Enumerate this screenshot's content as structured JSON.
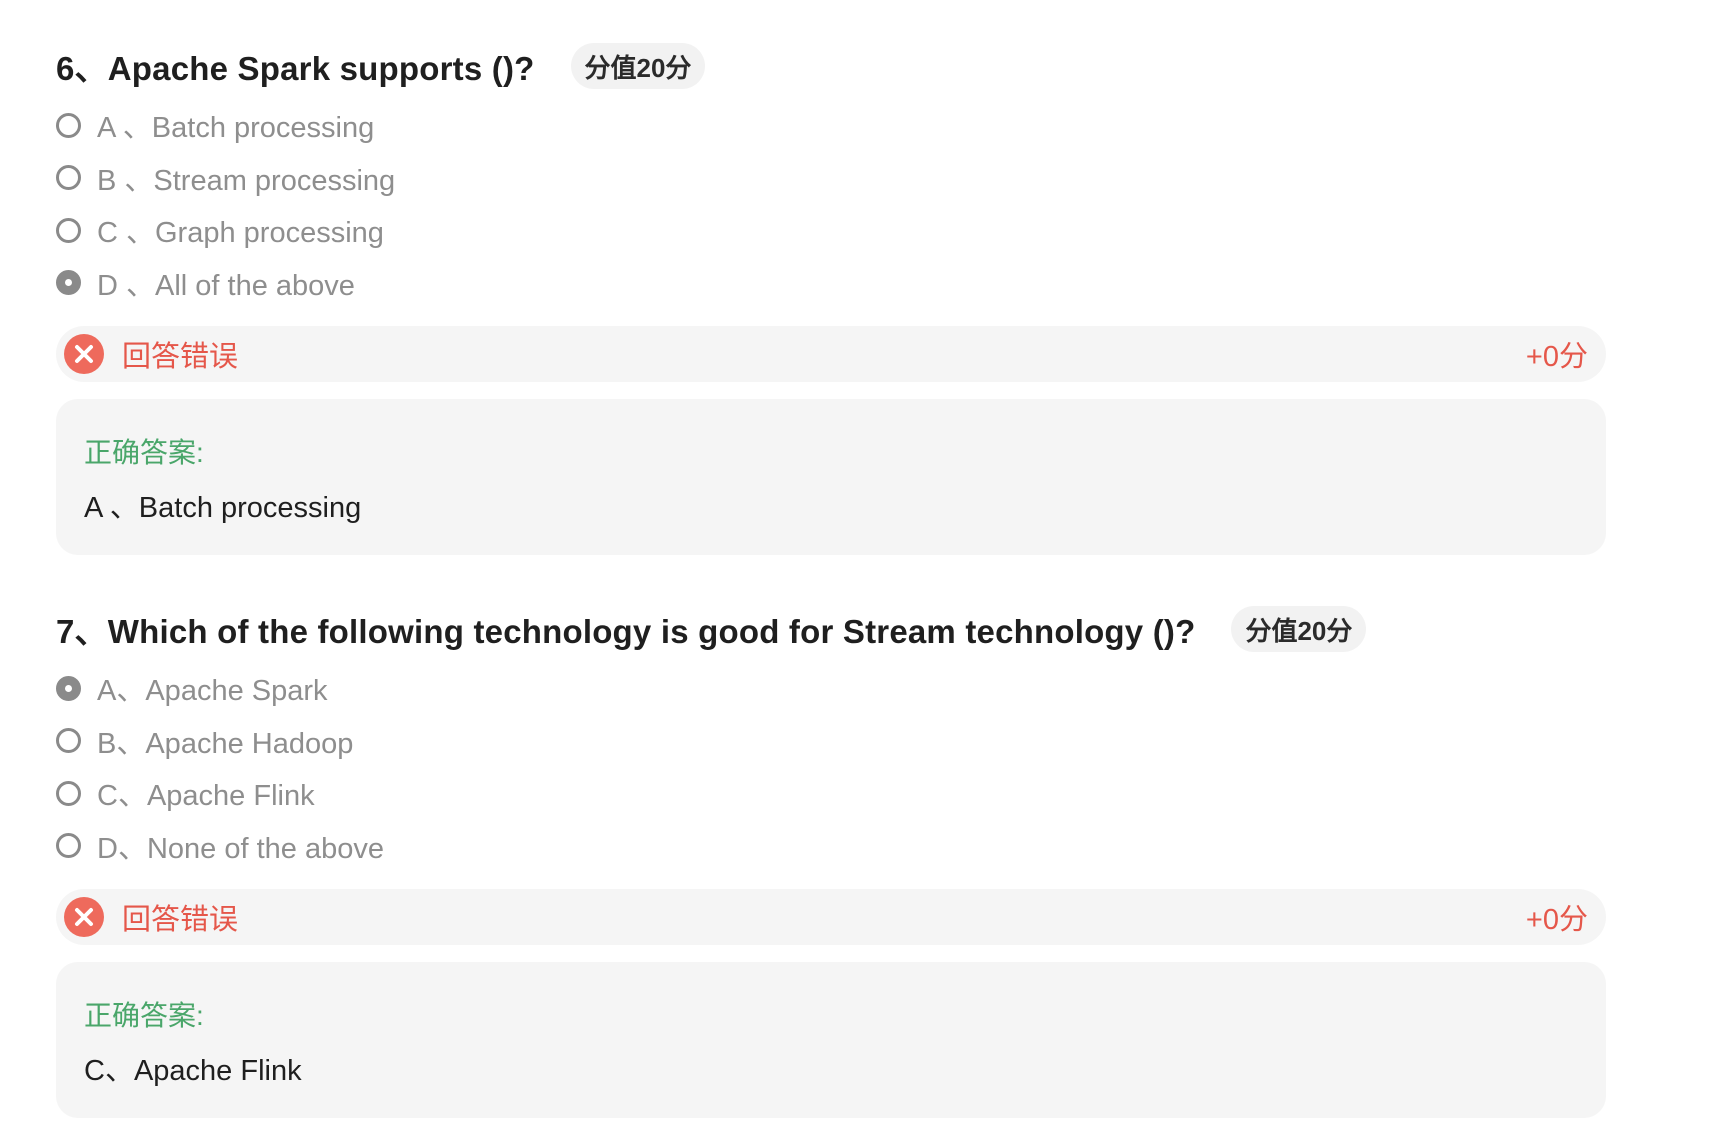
{
  "questions": [
    {
      "title": "6、Apache Spark supports ()?",
      "score_badge": "分值20分",
      "options": [
        {
          "label": "A 、Batch processing",
          "selected": false
        },
        {
          "label": "B 、Stream processing",
          "selected": false
        },
        {
          "label": "C 、Graph processing",
          "selected": false
        },
        {
          "label": "D 、All of the above",
          "selected": true
        }
      ],
      "result": {
        "status": "回答错误",
        "points": "+0分",
        "icon": "wrong-x-icon",
        "color": "#e5574a"
      },
      "correct": {
        "heading": "正确答案:",
        "answer": "A 、Batch processing",
        "heading_color": "#4aa66a"
      }
    },
    {
      "title": "7、Which of the following technology is good for Stream technology ()?",
      "score_badge": "分值20分",
      "options": [
        {
          "label": "A、Apache Spark",
          "selected": true
        },
        {
          "label": "B、Apache Hadoop",
          "selected": false
        },
        {
          "label": "C、Apache Flink",
          "selected": false
        },
        {
          "label": "D、None of the above",
          "selected": false
        }
      ],
      "result": {
        "status": "回答错误",
        "points": "+0分",
        "icon": "wrong-x-icon",
        "color": "#e5574a"
      },
      "correct": {
        "heading": "正确答案:",
        "answer": "C、Apache Flink",
        "heading_color": "#4aa66a"
      }
    }
  ]
}
